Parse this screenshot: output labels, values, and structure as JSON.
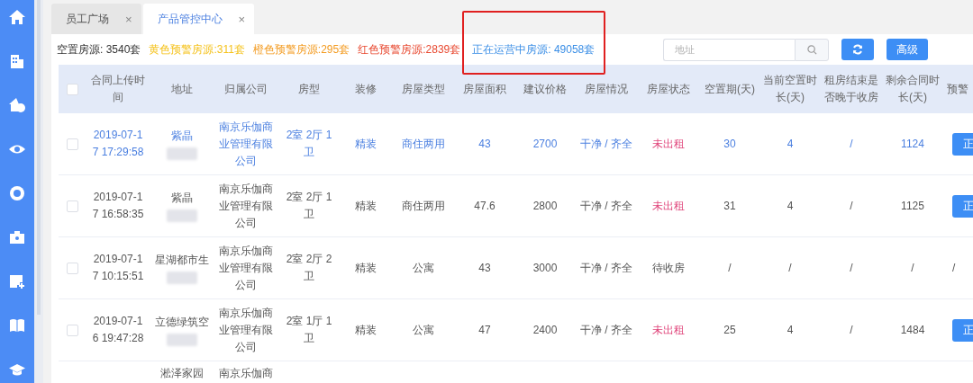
{
  "sidebar": {
    "items": [
      {
        "selected": false
      },
      {
        "selected": false
      },
      {
        "selected": false
      },
      {
        "selected": false
      },
      {
        "selected": false
      },
      {
        "selected": false
      },
      {
        "selected": false
      },
      {
        "selected": false
      },
      {
        "selected": false
      }
    ]
  },
  "tabs": [
    {
      "label": "员工广场",
      "selected": false,
      "close": "×"
    },
    {
      "label": "产品管控中心",
      "selected": true,
      "close": "×"
    }
  ],
  "stats": [
    {
      "text": "空置房源: 3540套",
      "color": "#333333",
      "highlighted": false
    },
    {
      "text": "黄色预警房源:311套",
      "color": "#f5c21b",
      "highlighted": false
    },
    {
      "text": "橙色预警房源:295套",
      "color": "#f39a1e",
      "highlighted": false
    },
    {
      "text": "红色预警房源:2839套",
      "color": "#e8482f",
      "highlighted": false
    },
    {
      "text": "正在运营中房源: 49058套",
      "color": "#3a8ee6",
      "highlighted": true
    }
  ],
  "search": {
    "placeholder": "地址"
  },
  "buttons": [
    {
      "kind": "refresh"
    },
    {
      "kind": "text",
      "label": "高级"
    }
  ],
  "table": {
    "header_checked": false,
    "columns": [
      "合同上传时间",
      "地址",
      "归属公司",
      "房型",
      "装修",
      "房屋类型",
      "房屋面积",
      "建议价格",
      "房屋情况",
      "房屋状态",
      "空置期(天)",
      "当前空置时长(天)",
      "租房结束是否晚于收房",
      "剩余合同时长(天)",
      "预警"
    ],
    "rows": [
      {
        "selected": true,
        "checked": false,
        "redacted": true,
        "cells": [
          "2019-07-17 17:29:58",
          "紫晶",
          "南京乐伽商业管理有限公司",
          "2室 2厅 1卫",
          "精装",
          "商住两用",
          "43",
          "2700",
          "干净 / 齐全"
        ],
        "status": {
          "text": "未出租",
          "color": "#e0457b"
        },
        "tail": [
          "30",
          "4",
          "/",
          "1124"
        ],
        "action": {
          "kind": "button",
          "text": "正"
        }
      },
      {
        "selected": false,
        "checked": false,
        "redacted": true,
        "cells": [
          "2019-07-17 16:58:35",
          "紫晶",
          "南京乐伽商业管理有限公司",
          "2室 2厅 1卫",
          "精装",
          "商住两用",
          "47.6",
          "2800",
          "干净 / 齐全"
        ],
        "status": {
          "text": "未出租",
          "color": "#e0457b"
        },
        "tail": [
          "31",
          "4",
          "/",
          "1125"
        ],
        "action": {
          "kind": "button",
          "text": "正"
        }
      },
      {
        "selected": false,
        "checked": false,
        "redacted": true,
        "cells": [
          "2019-07-17 10:15:51",
          "星湖都市生",
          "南京乐伽商业管理有限公司",
          "2室 2厅 2卫",
          "精装",
          "公寓",
          "43",
          "3000",
          "干净 / 齐全"
        ],
        "status": {
          "text": "待收房",
          "color": "#555555"
        },
        "tail": [
          "/",
          "/",
          "/",
          "/"
        ],
        "action": {
          "kind": "text",
          "text": "/"
        }
      },
      {
        "selected": false,
        "checked": false,
        "redacted": true,
        "cells": [
          "2019-07-16 19:47:28",
          "立德绿筑空",
          "南京乐伽商业管理有限公司",
          "2室 1厅 1卫",
          "精装",
          "公寓",
          "47",
          "2400",
          "干净 / 齐全"
        ],
        "status": {
          "text": "未出租",
          "color": "#e0457b"
        },
        "tail": [
          "25",
          "4",
          "/",
          "1484"
        ],
        "action": {
          "kind": "button",
          "text": "正"
        }
      }
    ],
    "partial_row": {
      "address": "淞泽家园",
      "company": "南京乐伽商"
    }
  }
}
